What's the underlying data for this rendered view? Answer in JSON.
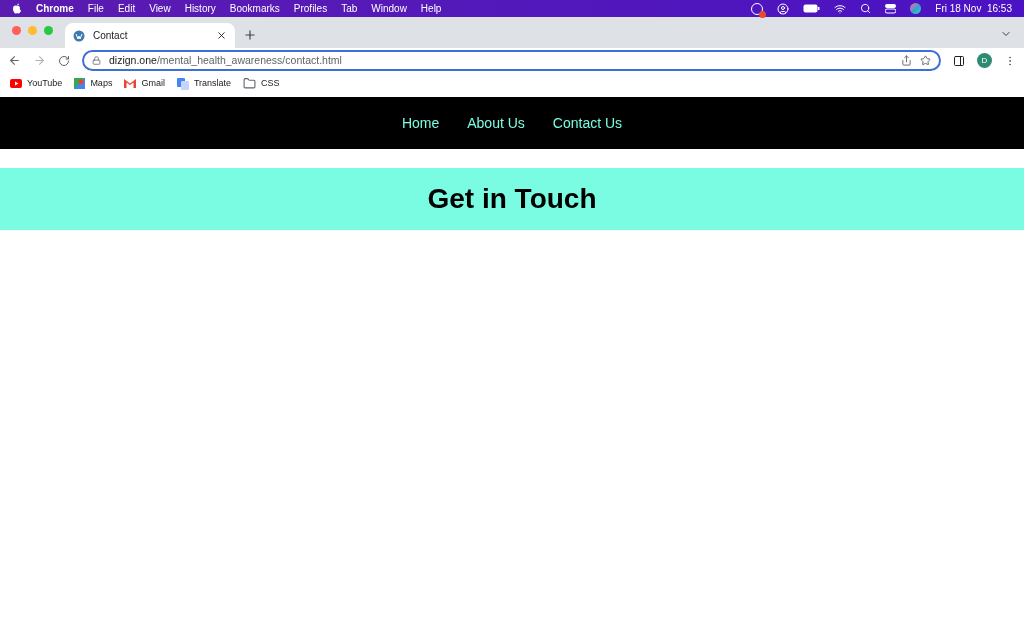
{
  "menu_bar": {
    "app": "Chrome",
    "items": [
      "File",
      "Edit",
      "View",
      "History",
      "Bookmarks",
      "Profiles",
      "Tab",
      "Window",
      "Help"
    ],
    "clock": "Fri 18 Nov  16:53"
  },
  "tab": {
    "title": "Contact",
    "selected": true
  },
  "address": {
    "domain": "dizign.one",
    "path": "/mental_health_awareness/contact.html"
  },
  "profile": {
    "initial": "D"
  },
  "bookmarks": [
    {
      "label": "YouTube",
      "kind": "youtube"
    },
    {
      "label": "Maps",
      "kind": "maps"
    },
    {
      "label": "Gmail",
      "kind": "gmail"
    },
    {
      "label": "Translate",
      "kind": "translate"
    },
    {
      "label": "CSS",
      "kind": "folder"
    }
  ],
  "nav": [
    {
      "label": "Home"
    },
    {
      "label": "About Us"
    },
    {
      "label": "Contact Us"
    }
  ],
  "heading": "Get in Touch"
}
